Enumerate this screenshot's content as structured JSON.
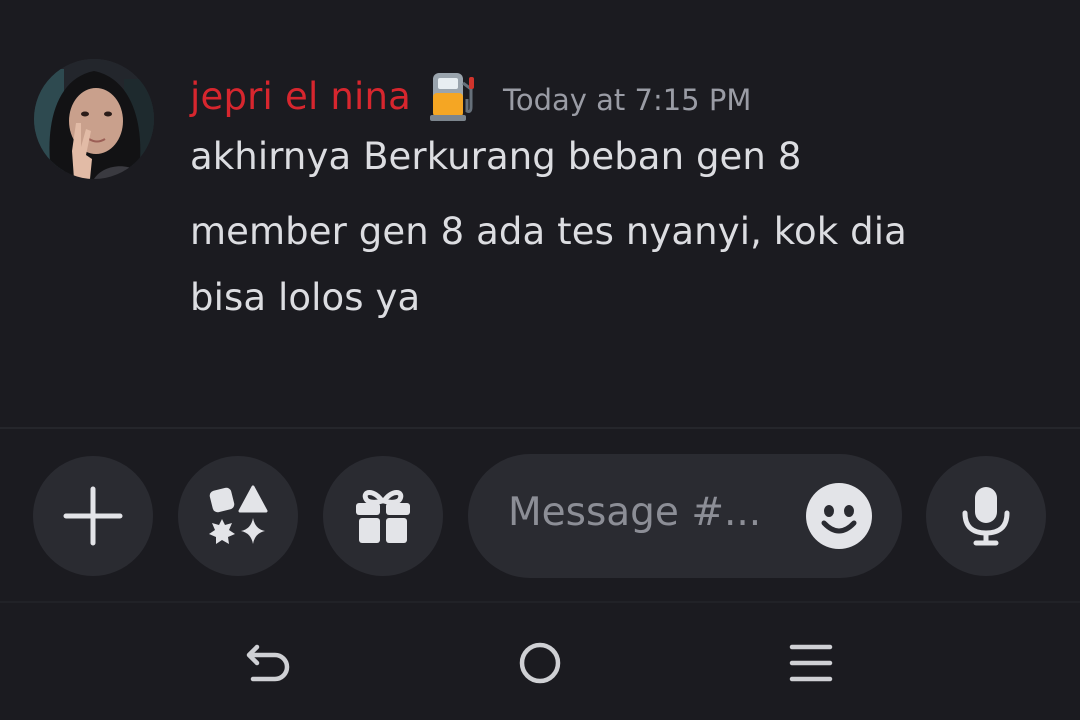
{
  "message": {
    "author": "jepri el nina",
    "author_color": "#d7262e",
    "author_badge_icon": "fuel-pump-icon",
    "timestamp": "Today at 7:15 PM",
    "lines": [
      "akhirnya Berkurang beban gen 8",
      "member gen 8 ada tes nyanyi, kok dia",
      "bisa lolos ya"
    ]
  },
  "composer": {
    "buttons": [
      {
        "name": "add-attachment-button",
        "icon": "plus-icon"
      },
      {
        "name": "apps-button",
        "icon": "apps-icon"
      },
      {
        "name": "gift-button",
        "icon": "gift-icon"
      },
      {
        "name": "voice-message-button",
        "icon": "microphone-icon"
      }
    ],
    "input": {
      "placeholder": "Message #...",
      "emoji_icon": "smiley-icon"
    }
  },
  "nav_bar": {
    "buttons": [
      {
        "name": "nav-back-button",
        "icon": "back-arrow-icon"
      },
      {
        "name": "nav-home-button",
        "icon": "home-circle-icon"
      },
      {
        "name": "nav-recents-button",
        "icon": "menu-lines-icon"
      }
    ]
  },
  "colors": {
    "background": "#1b1b20",
    "button_background": "#2a2b31",
    "message_text": "#dcdde1",
    "timestamp_text": "#9a9ca5",
    "placeholder_text": "#8c8e96",
    "icon": "#e3e4e8"
  }
}
